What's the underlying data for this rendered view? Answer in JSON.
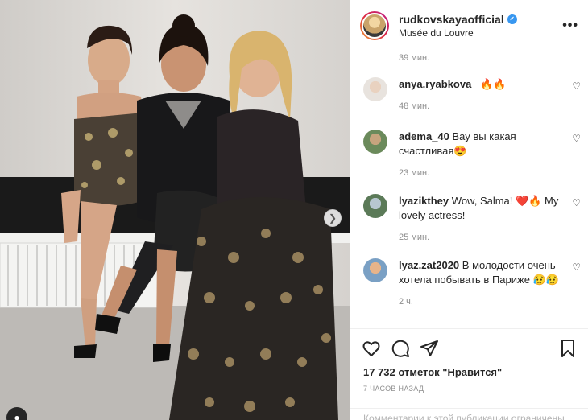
{
  "post": {
    "username": "rudkovskayaofficial",
    "location": "Musée du Louvre",
    "more_label": "•••",
    "verified_mark": "✓"
  },
  "photo": {
    "next_arrow": "❯",
    "tag_icon": "person-icon"
  },
  "comments_top_time": "39 мин.",
  "comments": [
    {
      "user": "anya.ryabkova_",
      "text": "",
      "emojis": "🔥🔥",
      "time": "48 мин."
    },
    {
      "user": "adema_40",
      "text": "Вау вы какая счастливая",
      "emojis": "😍",
      "time": "23 мин."
    },
    {
      "user": "lyazikthey",
      "text": "Wow, Salma! ❤️🔥 My lovely actress!",
      "emojis": "",
      "time": "25 мин."
    },
    {
      "user": "lyaz.zat2020",
      "text": "В молодости очень хотела побывать в Париже 😥😥",
      "emojis": "",
      "time": "2 ч."
    }
  ],
  "actions": {
    "likes": "17 732 отметок \"Нравится\"",
    "posted_ago": "7 ЧАСОВ НАЗАД",
    "comment_notice": "Комментарии к этой публикации ограничены"
  },
  "colors": {
    "verified": "#3897f0",
    "border": "#efefef",
    "muted": "#8e8e8e",
    "like_red": "#ed4956"
  }
}
